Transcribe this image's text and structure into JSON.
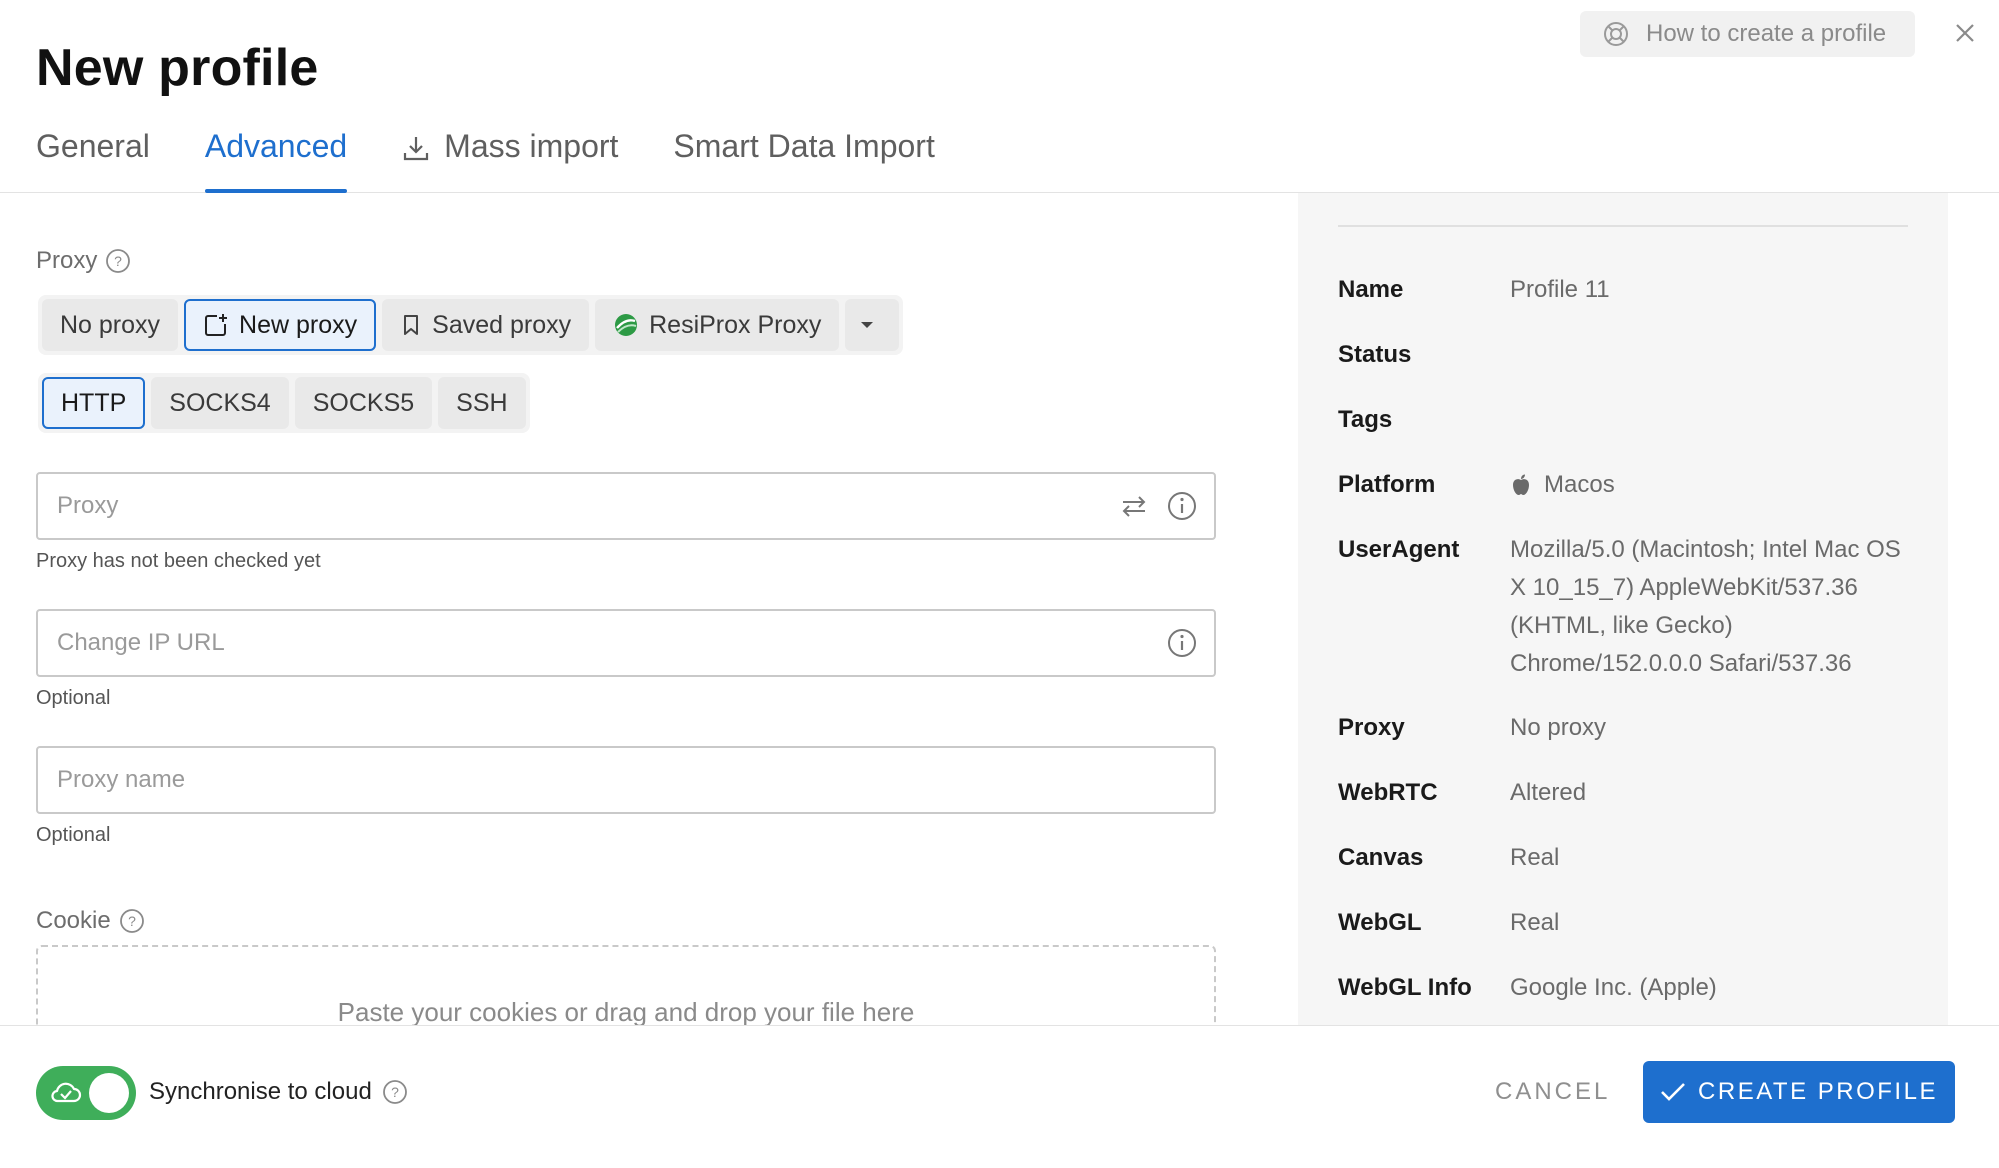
{
  "header": {
    "title": "New profile",
    "help_label": "How to create a profile",
    "tabs": [
      {
        "label": "General"
      },
      {
        "label": "Advanced"
      },
      {
        "label": "Mass import"
      },
      {
        "label": "Smart Data Import"
      }
    ]
  },
  "proxy": {
    "section_label": "Proxy",
    "modes": [
      {
        "label": "No proxy"
      },
      {
        "label": "New proxy"
      },
      {
        "label": "Saved proxy"
      },
      {
        "label": "ResiProx Proxy"
      }
    ],
    "selected_mode": "New proxy",
    "types": [
      "HTTP",
      "SOCKS4",
      "SOCKS5",
      "SSH"
    ],
    "selected_type": "HTTP",
    "proxy_field": {
      "placeholder": "Proxy",
      "value": "",
      "hint": "Proxy has not been checked yet"
    },
    "change_ip_field": {
      "placeholder": "Change IP URL",
      "value": "",
      "hint": "Optional"
    },
    "name_field": {
      "placeholder": "Proxy name",
      "value": "",
      "hint": "Optional"
    }
  },
  "cookie": {
    "section_label": "Cookie",
    "drop_text": "Paste your cookies or drag and drop your file here"
  },
  "summary": {
    "rows": [
      {
        "key": "Name",
        "value": "Profile 11"
      },
      {
        "key": "Status",
        "value": ""
      },
      {
        "key": "Tags",
        "value": ""
      },
      {
        "key": "Platform",
        "value": "Macos"
      },
      {
        "key": "UserAgent",
        "value": "Mozilla/5.0 (Macintosh; Intel Mac OS X 10_15_7) AppleWebKit/537.36 (KHTML, like Gecko) Chrome/152.0.0.0 Safari/537.36"
      },
      {
        "key": "Proxy",
        "value": "No proxy"
      },
      {
        "key": "WebRTC",
        "value": "Altered"
      },
      {
        "key": "Canvas",
        "value": "Real"
      },
      {
        "key": "WebGL",
        "value": "Real"
      },
      {
        "key": "WebGL Info",
        "value": "Google Inc. (Apple)"
      }
    ]
  },
  "footer": {
    "sync_label": "Synchronise to cloud",
    "sync_enabled": true,
    "cancel_label": "CANCEL",
    "create_label": "CREATE PROFILE"
  },
  "colors": {
    "accent": "#1e6fce",
    "toggle_on": "#3fae5a"
  }
}
